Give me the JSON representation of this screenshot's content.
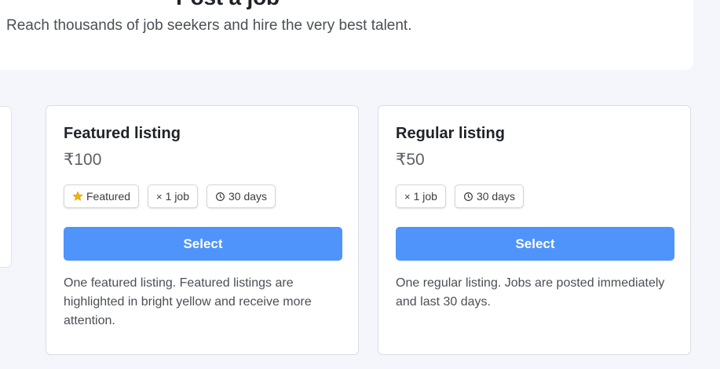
{
  "header": {
    "title": "Post a job",
    "subtitle": "Reach thousands of job seekers and hire the very best talent."
  },
  "plans": [
    {
      "name": "Featured listing",
      "price": "₹100",
      "tags": [
        {
          "icon": "star-icon",
          "label": "Featured"
        },
        {
          "icon": "times-icon",
          "label": "1 job"
        },
        {
          "icon": "clock-icon",
          "label": "30 days"
        }
      ],
      "button_label": "Select",
      "description": "One featured listing. Featured listings are highlighted in bright yellow and receive more attention."
    },
    {
      "name": "Regular listing",
      "price": "₹50",
      "tags": [
        {
          "icon": "times-icon",
          "label": "1 job"
        },
        {
          "icon": "clock-icon",
          "label": "30 days"
        }
      ],
      "button_label": "Select",
      "description": "One regular listing. Jobs are posted immediately and last 30 days."
    }
  ],
  "colors": {
    "accent": "#4f94fa",
    "star": "#f5b400",
    "page_background": "#f5f5fc"
  }
}
